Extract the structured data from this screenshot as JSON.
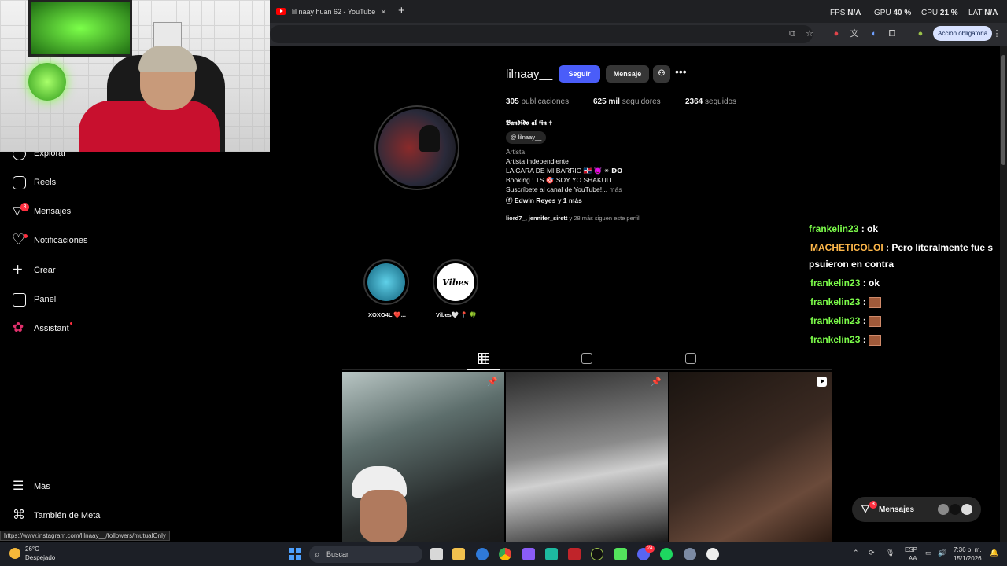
{
  "browser": {
    "tab_title": "lil naay huan 62 - YouTube",
    "new_tab": "+",
    "action_button": "Acción obligatoria",
    "status_url": "https://www.instagram.com/lilnaay__/followers/mutualOnly"
  },
  "perf_overlay": {
    "fps_label": "FPS",
    "fps_value": "N/A",
    "gpu_label": "GPU",
    "gpu_value": "40 %",
    "cpu_label": "CPU",
    "cpu_value": "21 %",
    "lat_label": "LAT",
    "lat_value": "N/A"
  },
  "sidebar": {
    "items": [
      {
        "label": "Explorar",
        "icon": "compass-icon"
      },
      {
        "label": "Reels",
        "icon": "reels-icon"
      },
      {
        "label": "Mensajes",
        "icon": "messenger-icon",
        "badge": "3"
      },
      {
        "label": "Notificaciones",
        "icon": "heart-icon"
      },
      {
        "label": "Crear",
        "icon": "plus-icon"
      },
      {
        "label": "Panel",
        "icon": "dashboard-icon"
      },
      {
        "label": "Assistant",
        "icon": "assistant-icon"
      },
      {
        "label": "Más",
        "icon": "menu-icon"
      },
      {
        "label": "También de Meta",
        "icon": "meta-icon"
      }
    ]
  },
  "profile": {
    "username": "lilnaay__",
    "follow_label": "Seguir",
    "message_label": "Mensaje",
    "more_label": "•••",
    "posts_count": "305",
    "posts_label": "publicaciones",
    "followers_count": "625 mil",
    "followers_label": "seguidores",
    "following_count": "2364",
    "following_label": "seguidos",
    "display_name": "𝕭𝖆𝖓𝖉𝖎𝖉𝖔 𝖆𝖑 𝖋𝖎𝖓 ✝",
    "threads_handle": "lilnaay__",
    "category": "Artista",
    "bio_line1": "Artista independiente",
    "bio_line2": "LA CARA DE MI BARRIO 🇩🇴 👿 ✴ 𝗗𝗢",
    "bio_line3": "Booking : TS 🎯 SOY YO SHAKULL",
    "bio_line4": "Suscríbete al canal de YouTube!...",
    "bio_more": "más",
    "link_text": "Edwin Reyes y 1 más",
    "followed_by_users": "liord7_, jennifer_sirett",
    "followed_by_rest": "y 28 más siguen este perfil",
    "highlights": [
      {
        "label": "XOXO4L 💔...",
        "cover": ""
      },
      {
        "label": "Vibes🤍 📍 🍀",
        "cover": "Vibes"
      }
    ]
  },
  "chat": [
    {
      "user": "frankelin23",
      "text": ": ok",
      "color": "#7cfc4a"
    },
    {
      "user": "MACHETICOLOI",
      "text": ": Pero literalmente fue s",
      "color": "#ffb84a"
    },
    {
      "user": "",
      "text": "psuieron en contra",
      "color": "#ffffff"
    },
    {
      "user": "frankelin23",
      "text": ": ok",
      "color": "#7cfc4a"
    },
    {
      "user": "frankelin23",
      "text": ":",
      "color": "#7cfc4a"
    },
    {
      "user": "frankelin23",
      "text": ":",
      "color": "#7cfc4a"
    },
    {
      "user": "frankelin23",
      "text": ":",
      "color": "#7cfc4a"
    }
  ],
  "messages_pill": {
    "label": "Mensajes",
    "badge": "3"
  },
  "taskbar": {
    "temp": "26°C",
    "condition": "Despejado",
    "search_placeholder": "Buscar",
    "lang1": "ESP",
    "lang2": "LAA",
    "time": "7:36 p. m.",
    "date": "15/1/2026",
    "discord_badge": "24"
  }
}
